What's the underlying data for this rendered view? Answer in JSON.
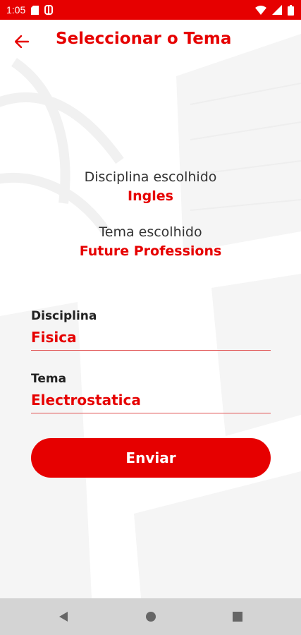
{
  "status_bar": {
    "time": "1:05"
  },
  "app_bar": {
    "title": "Seleccionar o Tema"
  },
  "summary": {
    "discipline_label": "Disciplina escolhido",
    "discipline_value": "Ingles",
    "theme_label": "Tema escolhido",
    "theme_value": "Future Professions"
  },
  "form": {
    "discipline_label": "Disciplina",
    "discipline_value": "Fisica",
    "theme_label": "Tema",
    "theme_value": "Electrostatica",
    "submit_label": "Enviar"
  },
  "colors": {
    "accent": "#e60000",
    "nav_bar": "#d4d4d4"
  }
}
